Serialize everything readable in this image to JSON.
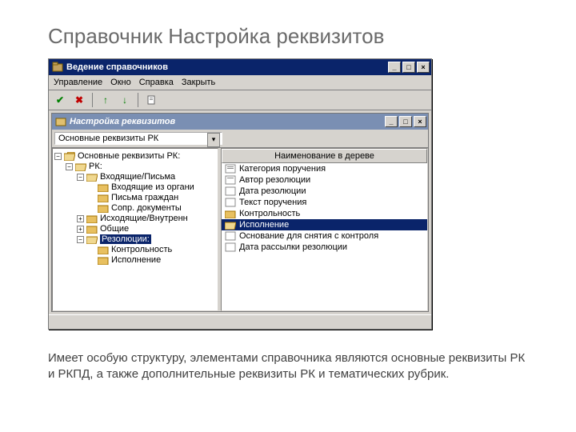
{
  "slide": {
    "title": "Справочник Настройка реквизитов",
    "caption": "Имеет особую структуру, элементами справочника являются основные реквизиты РК и РКПД, а также дополнительные реквизиты РК и тематических рубрик."
  },
  "outerWindow": {
    "title": "Ведение справочников",
    "menu": {
      "m1": "Управление",
      "m2": "Окно",
      "m3": "Справка",
      "m4": "Закрыть"
    }
  },
  "innerWindow": {
    "title": "Настройка реквизитов",
    "dropdown": "Основные реквизиты РК"
  },
  "tree": {
    "n0": "Основные реквизиты РК:",
    "n1": "РК:",
    "n2": "Входящие/Письма",
    "n3": "Входящие из органи",
    "n4": "Письма граждан",
    "n5": "Сопр. документы",
    "n6": "Исходящие/Внутренн",
    "n7": "Общие",
    "n8": "Резолюции:",
    "n9": "Контрольность",
    "n10": "Исполнение"
  },
  "list": {
    "header": "Наименование в дереве",
    "r0": "Категория поручения",
    "r1": "Автор резолюции",
    "r2": "Дата резолюции",
    "r3": "Текст поручения",
    "r4": "Контрольность",
    "r5": "Исполнение",
    "r6": "Основание для снятия с контроля",
    "r7": "Дата рассылки резолюции"
  }
}
